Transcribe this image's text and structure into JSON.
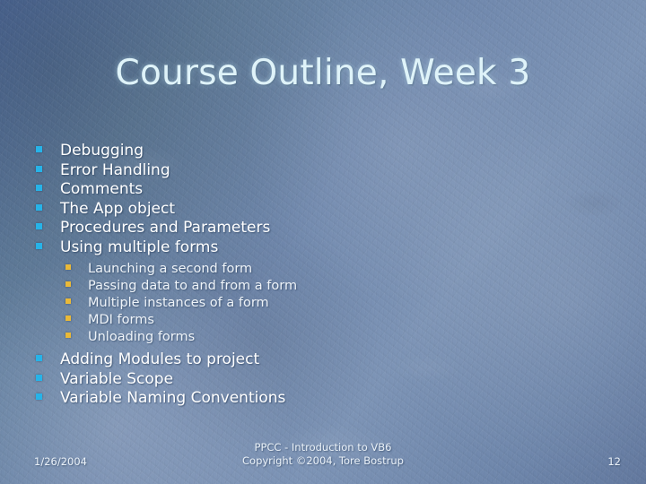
{
  "slide": {
    "title": "Course Outline, Week 3",
    "page_number": "12"
  },
  "colors": {
    "background_base": "#6f88ad",
    "background_dark": "#506c9c",
    "background_light": "#7d94b6",
    "title_text": "#dff3f9",
    "body_text": "#ffffff",
    "sub_text": "#eef3f8",
    "bullet_level1": "#27b3e8",
    "bullet_level2": "#e9b939",
    "footer_text": "#eaf1f8"
  },
  "outline": {
    "top_items": [
      {
        "label": "Debugging"
      },
      {
        "label": "Error Handling"
      },
      {
        "label": "Comments"
      },
      {
        "label": "The App object"
      },
      {
        "label": "Procedures and Parameters"
      },
      {
        "label": "Using multiple forms"
      }
    ],
    "sub_items": [
      {
        "label": "Launching a second form"
      },
      {
        "label": "Passing data to and from a form"
      },
      {
        "label": "Multiple instances of a form"
      },
      {
        "label": "MDI forms"
      },
      {
        "label": "Unloading forms"
      }
    ],
    "bottom_items": [
      {
        "label": "Adding Modules to project"
      },
      {
        "label": "Variable Scope"
      },
      {
        "label": "Variable Naming Conventions"
      }
    ]
  },
  "footer": {
    "date": "1/26/2004",
    "line1": "PPCC - Introduction to VB6",
    "line2": "Copyright ©2004, Tore Bostrup",
    "page_number": "12"
  }
}
